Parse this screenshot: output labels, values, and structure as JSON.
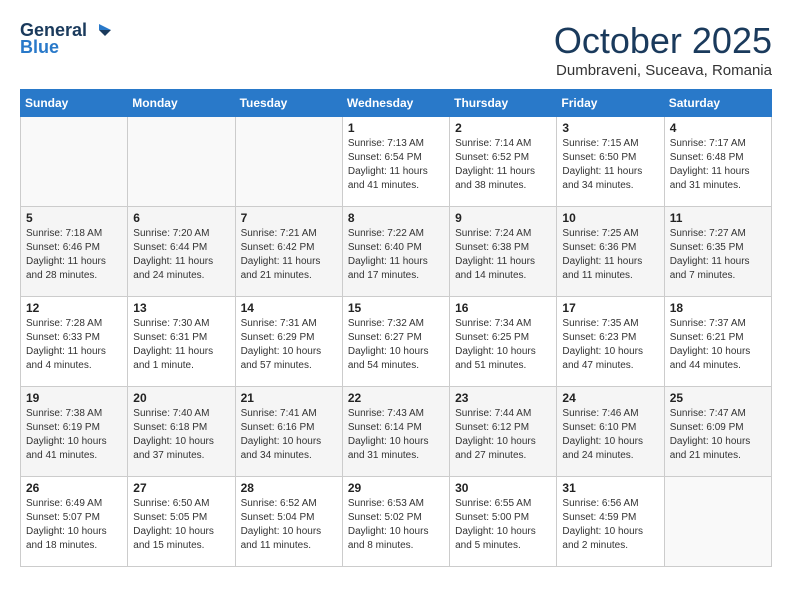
{
  "header": {
    "logo_line1": "General",
    "logo_line2": "Blue",
    "month": "October 2025",
    "location": "Dumbraveni, Suceava, Romania"
  },
  "weekdays": [
    "Sunday",
    "Monday",
    "Tuesday",
    "Wednesday",
    "Thursday",
    "Friday",
    "Saturday"
  ],
  "weeks": [
    [
      {
        "day": "",
        "sunrise": "",
        "sunset": "",
        "daylight": ""
      },
      {
        "day": "",
        "sunrise": "",
        "sunset": "",
        "daylight": ""
      },
      {
        "day": "",
        "sunrise": "",
        "sunset": "",
        "daylight": ""
      },
      {
        "day": "1",
        "sunrise": "Sunrise: 7:13 AM",
        "sunset": "Sunset: 6:54 PM",
        "daylight": "Daylight: 11 hours and 41 minutes."
      },
      {
        "day": "2",
        "sunrise": "Sunrise: 7:14 AM",
        "sunset": "Sunset: 6:52 PM",
        "daylight": "Daylight: 11 hours and 38 minutes."
      },
      {
        "day": "3",
        "sunrise": "Sunrise: 7:15 AM",
        "sunset": "Sunset: 6:50 PM",
        "daylight": "Daylight: 11 hours and 34 minutes."
      },
      {
        "day": "4",
        "sunrise": "Sunrise: 7:17 AM",
        "sunset": "Sunset: 6:48 PM",
        "daylight": "Daylight: 11 hours and 31 minutes."
      }
    ],
    [
      {
        "day": "5",
        "sunrise": "Sunrise: 7:18 AM",
        "sunset": "Sunset: 6:46 PM",
        "daylight": "Daylight: 11 hours and 28 minutes."
      },
      {
        "day": "6",
        "sunrise": "Sunrise: 7:20 AM",
        "sunset": "Sunset: 6:44 PM",
        "daylight": "Daylight: 11 hours and 24 minutes."
      },
      {
        "day": "7",
        "sunrise": "Sunrise: 7:21 AM",
        "sunset": "Sunset: 6:42 PM",
        "daylight": "Daylight: 11 hours and 21 minutes."
      },
      {
        "day": "8",
        "sunrise": "Sunrise: 7:22 AM",
        "sunset": "Sunset: 6:40 PM",
        "daylight": "Daylight: 11 hours and 17 minutes."
      },
      {
        "day": "9",
        "sunrise": "Sunrise: 7:24 AM",
        "sunset": "Sunset: 6:38 PM",
        "daylight": "Daylight: 11 hours and 14 minutes."
      },
      {
        "day": "10",
        "sunrise": "Sunrise: 7:25 AM",
        "sunset": "Sunset: 6:36 PM",
        "daylight": "Daylight: 11 hours and 11 minutes."
      },
      {
        "day": "11",
        "sunrise": "Sunrise: 7:27 AM",
        "sunset": "Sunset: 6:35 PM",
        "daylight": "Daylight: 11 hours and 7 minutes."
      }
    ],
    [
      {
        "day": "12",
        "sunrise": "Sunrise: 7:28 AM",
        "sunset": "Sunset: 6:33 PM",
        "daylight": "Daylight: 11 hours and 4 minutes."
      },
      {
        "day": "13",
        "sunrise": "Sunrise: 7:30 AM",
        "sunset": "Sunset: 6:31 PM",
        "daylight": "Daylight: 11 hours and 1 minute."
      },
      {
        "day": "14",
        "sunrise": "Sunrise: 7:31 AM",
        "sunset": "Sunset: 6:29 PM",
        "daylight": "Daylight: 10 hours and 57 minutes."
      },
      {
        "day": "15",
        "sunrise": "Sunrise: 7:32 AM",
        "sunset": "Sunset: 6:27 PM",
        "daylight": "Daylight: 10 hours and 54 minutes."
      },
      {
        "day": "16",
        "sunrise": "Sunrise: 7:34 AM",
        "sunset": "Sunset: 6:25 PM",
        "daylight": "Daylight: 10 hours and 51 minutes."
      },
      {
        "day": "17",
        "sunrise": "Sunrise: 7:35 AM",
        "sunset": "Sunset: 6:23 PM",
        "daylight": "Daylight: 10 hours and 47 minutes."
      },
      {
        "day": "18",
        "sunrise": "Sunrise: 7:37 AM",
        "sunset": "Sunset: 6:21 PM",
        "daylight": "Daylight: 10 hours and 44 minutes."
      }
    ],
    [
      {
        "day": "19",
        "sunrise": "Sunrise: 7:38 AM",
        "sunset": "Sunset: 6:19 PM",
        "daylight": "Daylight: 10 hours and 41 minutes."
      },
      {
        "day": "20",
        "sunrise": "Sunrise: 7:40 AM",
        "sunset": "Sunset: 6:18 PM",
        "daylight": "Daylight: 10 hours and 37 minutes."
      },
      {
        "day": "21",
        "sunrise": "Sunrise: 7:41 AM",
        "sunset": "Sunset: 6:16 PM",
        "daylight": "Daylight: 10 hours and 34 minutes."
      },
      {
        "day": "22",
        "sunrise": "Sunrise: 7:43 AM",
        "sunset": "Sunset: 6:14 PM",
        "daylight": "Daylight: 10 hours and 31 minutes."
      },
      {
        "day": "23",
        "sunrise": "Sunrise: 7:44 AM",
        "sunset": "Sunset: 6:12 PM",
        "daylight": "Daylight: 10 hours and 27 minutes."
      },
      {
        "day": "24",
        "sunrise": "Sunrise: 7:46 AM",
        "sunset": "Sunset: 6:10 PM",
        "daylight": "Daylight: 10 hours and 24 minutes."
      },
      {
        "day": "25",
        "sunrise": "Sunrise: 7:47 AM",
        "sunset": "Sunset: 6:09 PM",
        "daylight": "Daylight: 10 hours and 21 minutes."
      }
    ],
    [
      {
        "day": "26",
        "sunrise": "Sunrise: 6:49 AM",
        "sunset": "Sunset: 5:07 PM",
        "daylight": "Daylight: 10 hours and 18 minutes."
      },
      {
        "day": "27",
        "sunrise": "Sunrise: 6:50 AM",
        "sunset": "Sunset: 5:05 PM",
        "daylight": "Daylight: 10 hours and 15 minutes."
      },
      {
        "day": "28",
        "sunrise": "Sunrise: 6:52 AM",
        "sunset": "Sunset: 5:04 PM",
        "daylight": "Daylight: 10 hours and 11 minutes."
      },
      {
        "day": "29",
        "sunrise": "Sunrise: 6:53 AM",
        "sunset": "Sunset: 5:02 PM",
        "daylight": "Daylight: 10 hours and 8 minutes."
      },
      {
        "day": "30",
        "sunrise": "Sunrise: 6:55 AM",
        "sunset": "Sunset: 5:00 PM",
        "daylight": "Daylight: 10 hours and 5 minutes."
      },
      {
        "day": "31",
        "sunrise": "Sunrise: 6:56 AM",
        "sunset": "Sunset: 4:59 PM",
        "daylight": "Daylight: 10 hours and 2 minutes."
      },
      {
        "day": "",
        "sunrise": "",
        "sunset": "",
        "daylight": ""
      }
    ]
  ]
}
